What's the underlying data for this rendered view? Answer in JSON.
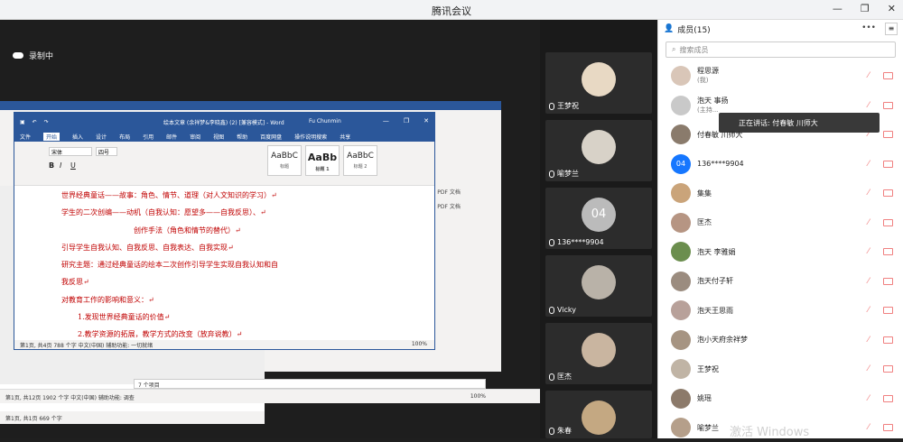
{
  "app": {
    "title": "腾讯会议"
  },
  "recording": {
    "label": "录制中"
  },
  "word_back": {
    "title_fragment": "小目睛 (学散、学数能) (1) [兼容模式] - Word",
    "status": "第1页, 共1页   669 个字"
  },
  "word_third": {
    "side_items": [
      "类型",
      "WPS PDF 文档",
      "WPS PDF 文档"
    ]
  },
  "big_status": {
    "text": "第1页, 共12页   1902 个字   中文(中国)   辅助功能: 调查",
    "zoom": "100%"
  },
  "page_counter": "7 个项目",
  "word_front": {
    "doc_title": "绘本文章 (余祥梦&李晓鑫) (2) [兼容模式] - Word",
    "user": "Fu Chunmin",
    "menu": [
      "文件",
      "开始",
      "插入",
      "设计",
      "布局",
      "引用",
      "邮件",
      "审阅",
      "视图",
      "帮助",
      "百度网盘",
      "操作说明搜索",
      "共享"
    ],
    "active_menu": "开始",
    "font_name": "宋体",
    "font_size": "四号",
    "styles": [
      {
        "sample": "AaBbC",
        "name": "标题"
      },
      {
        "sample": "AaBb",
        "name": "标题 1"
      },
      {
        "sample": "AaBbC",
        "name": "标题 2"
      }
    ],
    "lines": [
      "世界经典童话——故事：角色、情节、道理（对人文知识的学习）↵",
      "学生的二次创编——动机（自我认知：愿望多——自我反思）、↵",
      "创作手法（角色和情节的替代）↵",
      "引导学生自我认知、自我反思、自我表达、自我实现↵",
      "研究主题：通过经典童话的绘本二次创作引导学生实现自我认知和自",
      "我反思↵",
      "对教育工作的影响和意义：↵",
      "1.发现世界经典童话的价值↵",
      "2.教学资源的拓展，教学方式的改变（放弃说教）↵"
    ],
    "status": "第1页, 共4页   788 个字   中文(中国)   辅助功能: 一切就绪",
    "zoom": "100%"
  },
  "video_tiles": [
    {
      "name": "王梦祝"
    },
    {
      "name": "喻梦兰"
    },
    {
      "name": "136****9904",
      "initials": "04"
    },
    {
      "name": "Vicky"
    },
    {
      "name": "匡杰"
    },
    {
      "name": "朱春"
    }
  ],
  "members": {
    "header": "成员(15)",
    "search_placeholder": "搜索成员",
    "list": [
      {
        "name": "程思源",
        "sub": "(我)"
      },
      {
        "name": "泡天 事扬",
        "sub": "(主持..."
      },
      {
        "name": "付春敏 川师大",
        "sub": ""
      },
      {
        "name": "136****9904",
        "sub": "",
        "initials": "04"
      },
      {
        "name": "集集",
        "sub": ""
      },
      {
        "name": "匡杰",
        "sub": ""
      },
      {
        "name": "泡天 李雅娟",
        "sub": ""
      },
      {
        "name": "泡天付子轩",
        "sub": ""
      },
      {
        "name": "泡天王思雨",
        "sub": ""
      },
      {
        "name": "泡小天府余祥梦",
        "sub": ""
      },
      {
        "name": "王梦祝",
        "sub": ""
      },
      {
        "name": "姚瑶",
        "sub": ""
      },
      {
        "name": "喻梦兰",
        "sub": ""
      }
    ],
    "speaking": "正在讲话: 付春敏 川师大"
  },
  "watermark": "激活 Windows",
  "colors": {
    "word_blue": "#2b579a",
    "doc_red": "#c00000",
    "badge_blue": "#1677ff",
    "muted_red": "#f08080"
  }
}
